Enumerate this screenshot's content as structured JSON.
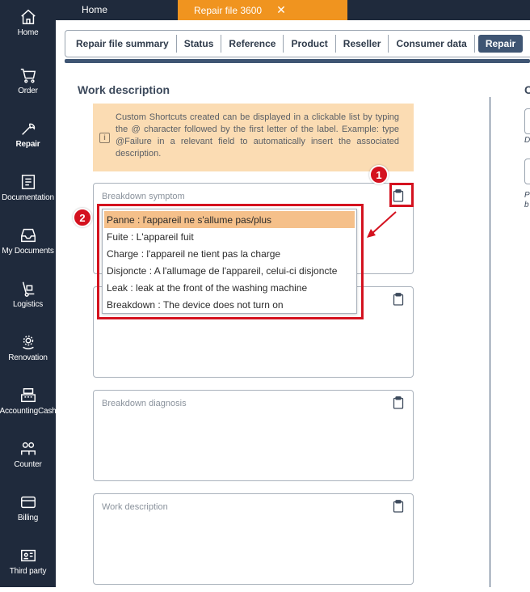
{
  "sidebar": {
    "items": [
      {
        "label": "Home",
        "icon": "home-icon"
      },
      {
        "label": "Order",
        "icon": "cart-icon"
      },
      {
        "label": "Repair",
        "icon": "wrench-icon"
      },
      {
        "label": "Documentation",
        "icon": "document-icon"
      },
      {
        "label": "My Documents",
        "icon": "inbox-icon"
      },
      {
        "label": "Logistics",
        "icon": "hand-truck-icon"
      },
      {
        "label": "Renovation",
        "icon": "gear-recycle-icon"
      },
      {
        "label": "AccountingCash",
        "icon": "cash-register-icon"
      },
      {
        "label": "Counter",
        "icon": "users-icon"
      },
      {
        "label": "Billing",
        "icon": "card-icon"
      },
      {
        "label": "Third party",
        "icon": "id-card-icon"
      }
    ]
  },
  "tabs": {
    "home": "Home",
    "active": "Repair file 3600",
    "close": "✕"
  },
  "subtabs": [
    "Repair file summary",
    "Status",
    "Reference",
    "Product",
    "Reseller",
    "Consumer data",
    "Repair"
  ],
  "section": {
    "title": "Work description"
  },
  "right_column": {
    "title_partial": "C",
    "d_partial": "D",
    "p_partial": "P",
    "b_partial": "b"
  },
  "info": {
    "icon": "info-icon",
    "text": "Custom Shortcuts created can be displayed in a clickable list by typing the @ character followed by the first letter of the label. Example: type @Failure in a relevant field to automatically insert the associated description."
  },
  "fields": [
    {
      "label": "Breakdown symptom"
    },
    {
      "label": ""
    },
    {
      "label": "Breakdown diagnosis"
    },
    {
      "label": "Work description"
    }
  ],
  "dropdown": {
    "items": [
      "Panne : l'appareil ne s'allume pas/plus",
      "Fuite : L'appareil fuit",
      "Charge : l'appareil ne tient pas la charge",
      "Disjoncte : A l'allumage de l'appareil, celui-ci disjoncte",
      "Leak : leak at the front of the washing machine",
      "Breakdown : The device does not turn on"
    ]
  },
  "annotations": {
    "badge1": "1",
    "badge2": "2",
    "color": "#d4121f"
  },
  "colors": {
    "sidebar": "#1f2a3c",
    "active_tab": "#f0941f",
    "info_bg": "#fbdcb3",
    "highlight": "#f5c08a"
  }
}
